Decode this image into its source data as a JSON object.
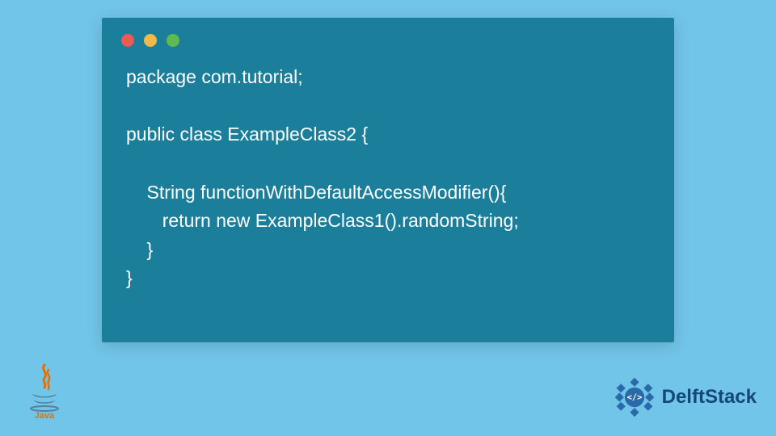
{
  "window": {
    "traffic_lights": {
      "red": "#eb5a55",
      "yellow": "#f2b94a",
      "green": "#5fbb50"
    }
  },
  "code": {
    "lines": [
      "package com.tutorial;",
      "",
      "public class ExampleClass2 {",
      "",
      "    String functionWithDefaultAccessModifier(){",
      "       return new ExampleClass1().randomString;",
      "    }",
      "}"
    ]
  },
  "logos": {
    "java": {
      "label": "Java",
      "color_accent": "#e76f00"
    },
    "delftstack": {
      "label": "DelftStack",
      "color_accent": "#2b6aa8"
    }
  }
}
